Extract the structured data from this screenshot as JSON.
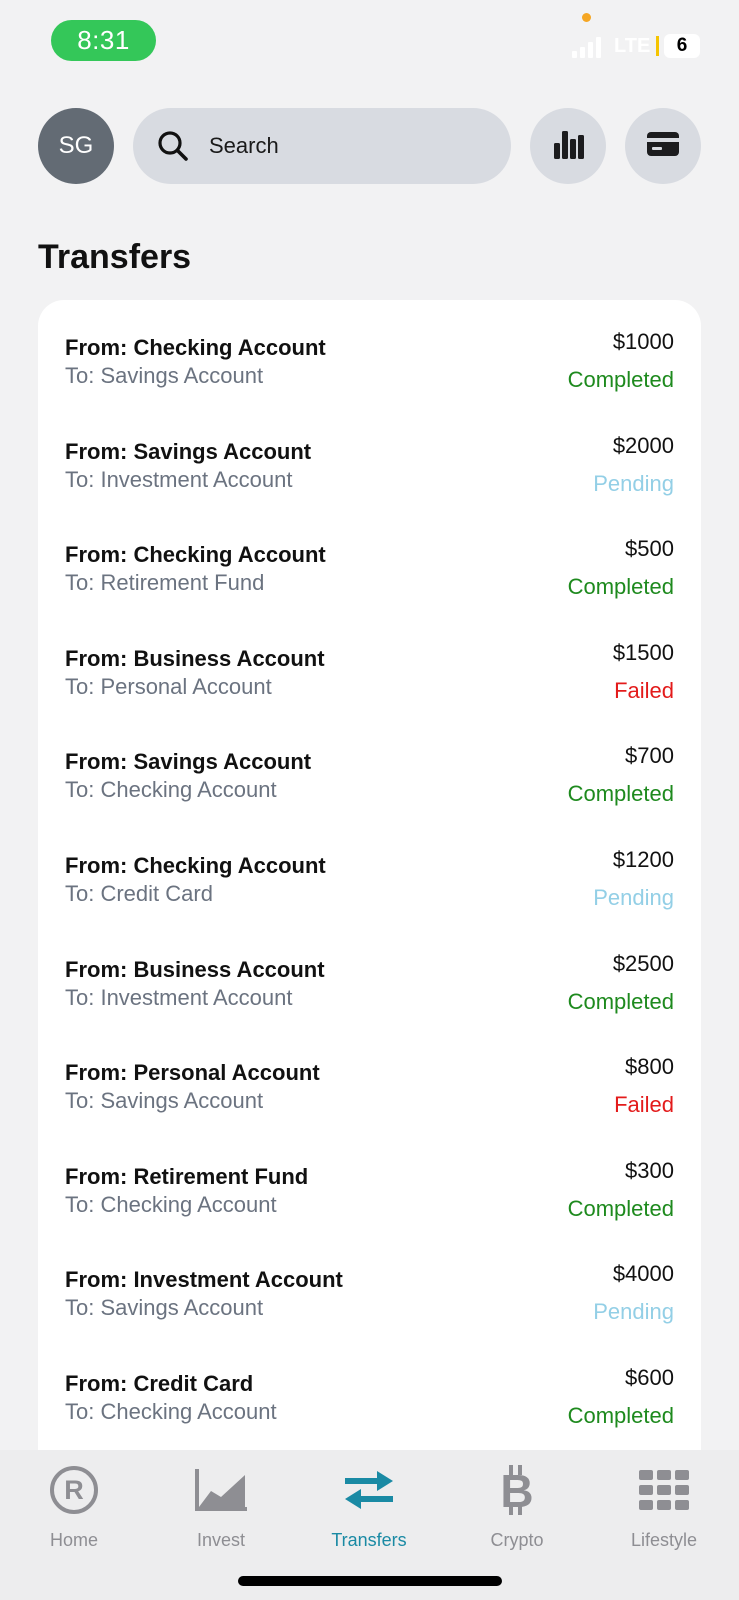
{
  "status_bar": {
    "time": "8:31",
    "network": "LTE",
    "battery": "6"
  },
  "header": {
    "avatar_initials": "SG",
    "search_placeholder": "Search",
    "stats_icon": "bar-chart-icon",
    "card_icon": "credit-card-icon"
  },
  "page_title": "Transfers",
  "colors": {
    "completed": "#1e8a1e",
    "pending": "#93cfe6",
    "failed": "#e31b1b",
    "active_tab": "#1a8aa4"
  },
  "transfers": [
    {
      "from": "From: Checking Account",
      "to": "To: Savings Account",
      "amount": "$1000",
      "status": "Completed"
    },
    {
      "from": "From: Savings Account",
      "to": "To: Investment Account",
      "amount": "$2000",
      "status": "Pending"
    },
    {
      "from": "From: Checking Account",
      "to": "To: Retirement Fund",
      "amount": "$500",
      "status": "Completed"
    },
    {
      "from": "From: Business Account",
      "to": "To: Personal Account",
      "amount": "$1500",
      "status": "Failed"
    },
    {
      "from": "From: Savings Account",
      "to": "To: Checking Account",
      "amount": "$700",
      "status": "Completed"
    },
    {
      "from": "From: Checking Account",
      "to": "To: Credit Card",
      "amount": "$1200",
      "status": "Pending"
    },
    {
      "from": "From: Business Account",
      "to": "To: Investment Account",
      "amount": "$2500",
      "status": "Completed"
    },
    {
      "from": "From: Personal Account",
      "to": "To: Savings Account",
      "amount": "$800",
      "status": "Failed"
    },
    {
      "from": "From: Retirement Fund",
      "to": "To: Checking Account",
      "amount": "$300",
      "status": "Completed"
    },
    {
      "from": "From: Investment Account",
      "to": "To: Savings Account",
      "amount": "$4000",
      "status": "Pending"
    },
    {
      "from": "From: Credit Card",
      "to": "To: Checking Account",
      "amount": "$600",
      "status": "Completed"
    }
  ],
  "tabs": [
    {
      "label": "Home",
      "icon": "robinhood-logo-icon",
      "active": false
    },
    {
      "label": "Invest",
      "icon": "line-chart-icon",
      "active": false
    },
    {
      "label": "Transfers",
      "icon": "transfer-arrows-icon",
      "active": true
    },
    {
      "label": "Crypto",
      "icon": "bitcoin-icon",
      "active": false
    },
    {
      "label": "Lifestyle",
      "icon": "grid-icon",
      "active": false
    }
  ]
}
